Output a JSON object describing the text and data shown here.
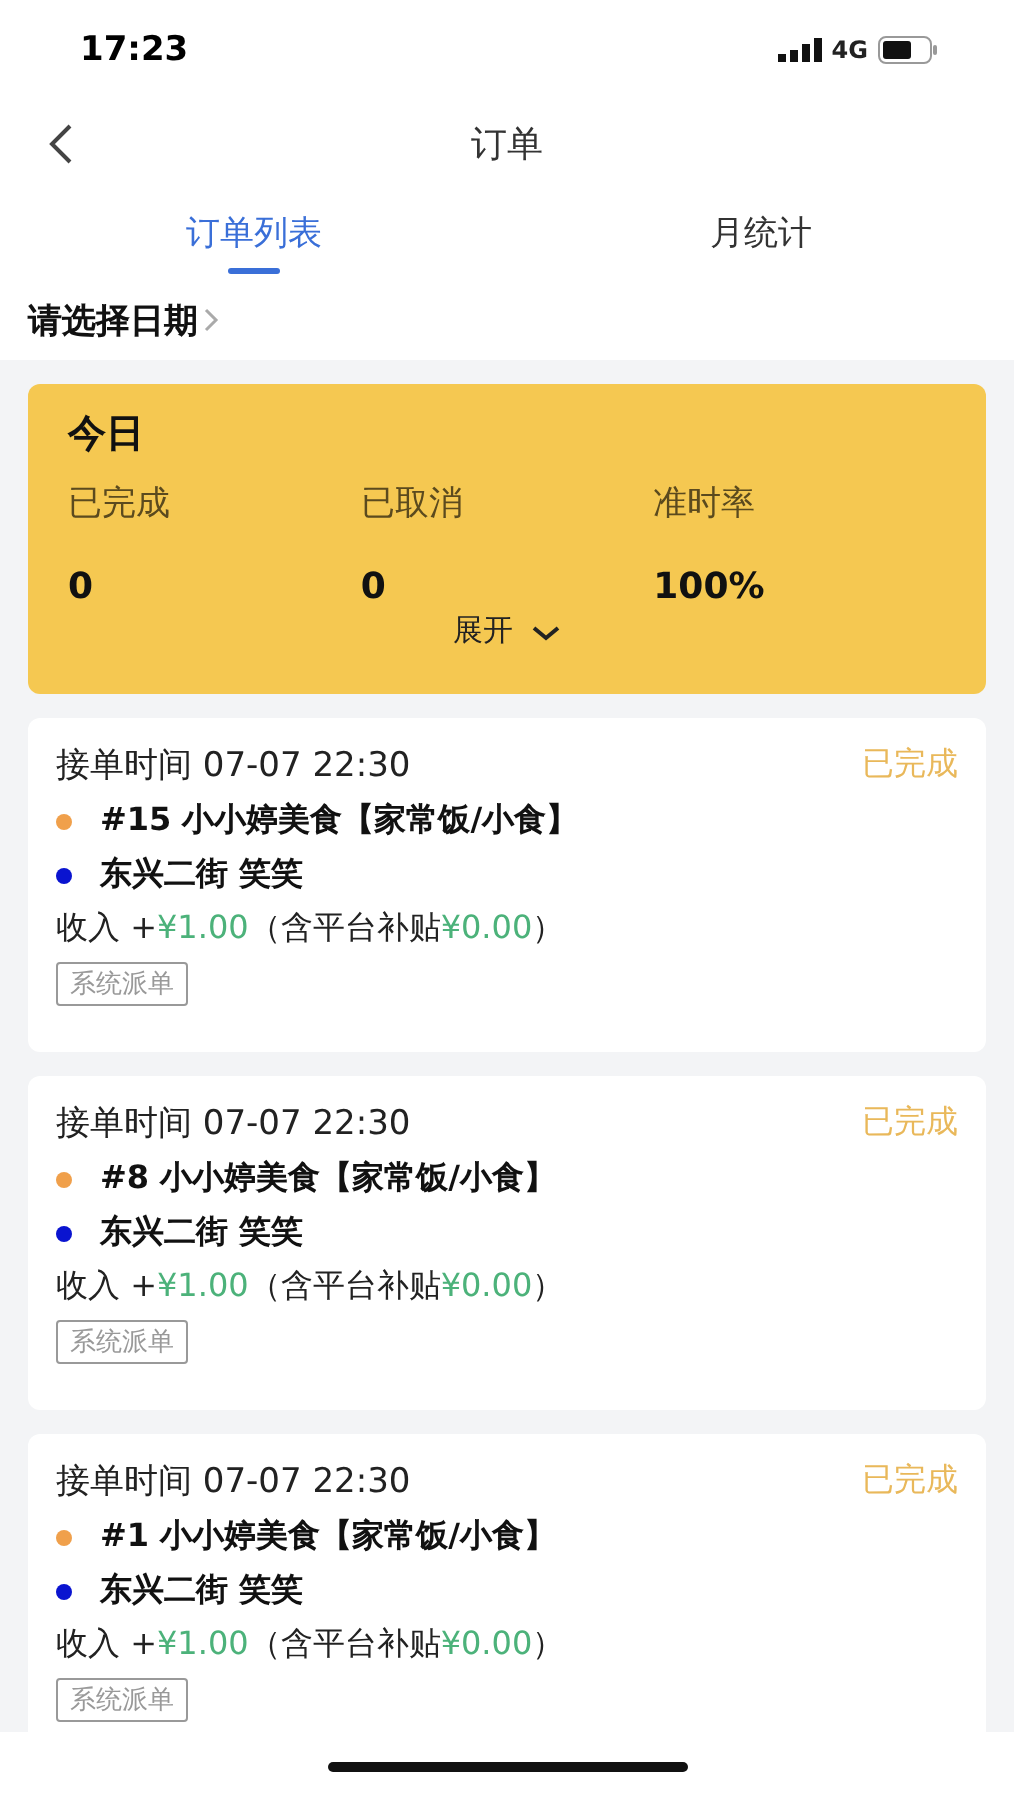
{
  "status_bar": {
    "time": "17:23",
    "network": "4G"
  },
  "nav": {
    "title": "订单"
  },
  "tabs": [
    {
      "label": "订单列表",
      "selected": true
    },
    {
      "label": "月统计",
      "selected": false
    }
  ],
  "date_picker": {
    "label": "请选择日期"
  },
  "summary": {
    "title": "今日",
    "stats": [
      {
        "label": "已完成",
        "value": "0"
      },
      {
        "label": "已取消",
        "value": "0"
      },
      {
        "label": "准时率",
        "value": "100%"
      }
    ],
    "expand": "展开",
    "expanded": false
  },
  "orders": [
    {
      "time": "接单时间 07-07 22:30",
      "status": "已完成",
      "stops": [
        {
          "text": "#15 小小婷美食【家常饭/小食】",
          "color": "#f0a04b"
        },
        {
          "text": "东兴二街 笑笑",
          "color": "#0a14d0"
        }
      ],
      "income_label": "收入 +",
      "income": "¥1.00",
      "subsidy_label": "（含平台补贴",
      "subsidy": "¥0.00",
      "income_end": "）",
      "tag": "系统派单"
    },
    {
      "time": "接单时间 07-07 22:30",
      "status": "已完成",
      "stops": [
        {
          "text": "#8 小小婷美食【家常饭/小食】",
          "color": "#f0a04b"
        },
        {
          "text": "东兴二街 笑笑",
          "color": "#0a14d0"
        }
      ],
      "income_label": "收入 +",
      "income": "¥1.00",
      "subsidy_label": "（含平台补贴",
      "subsidy": "¥0.00",
      "income_end": "）",
      "tag": "系统派单"
    },
    {
      "time": "接单时间 07-07 22:30",
      "status": "已完成",
      "stops": [
        {
          "text": "#1 小小婷美食【家常饭/小食】",
          "color": "#f0a04b"
        },
        {
          "text": "东兴二街 笑笑",
          "color": "#0a14d0"
        }
      ],
      "income_label": "收入 +",
      "income": "¥1.00",
      "subsidy_label": "（含平台补贴",
      "subsidy": "¥0.00",
      "income_end": "）",
      "tag": "系统派单"
    }
  ]
}
